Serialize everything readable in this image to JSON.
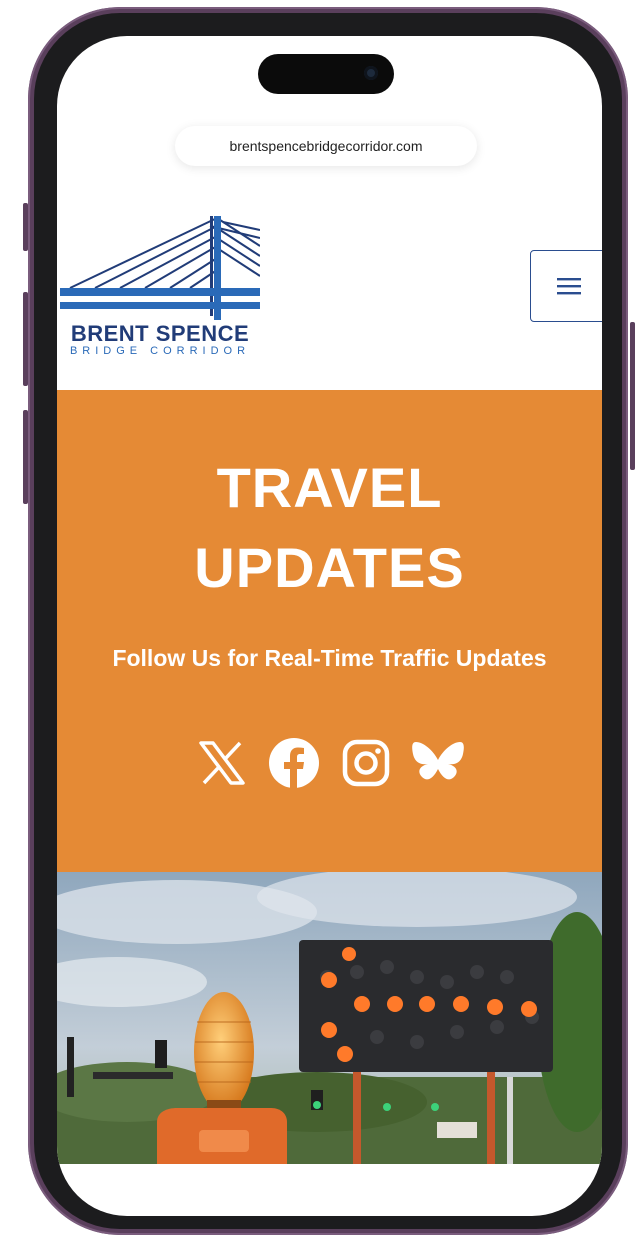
{
  "browser": {
    "url": "brentspencebridgecorridor.com"
  },
  "logo": {
    "title": "BRENT SPENCE",
    "subtitle": "BRIDGE CORRIDOR"
  },
  "hero": {
    "title_line1": "TRAVEL",
    "title_line2": "UPDATES",
    "subtitle": "Follow Us for Real-Time Traffic Updates",
    "background_color": "#e58a35"
  },
  "social_icons": [
    "x-icon",
    "facebook-icon",
    "instagram-icon",
    "bluesky-icon"
  ],
  "colors": {
    "brand_navy": "#213c78",
    "brand_blue": "#2a6ab8",
    "accent_orange": "#e58a35"
  }
}
